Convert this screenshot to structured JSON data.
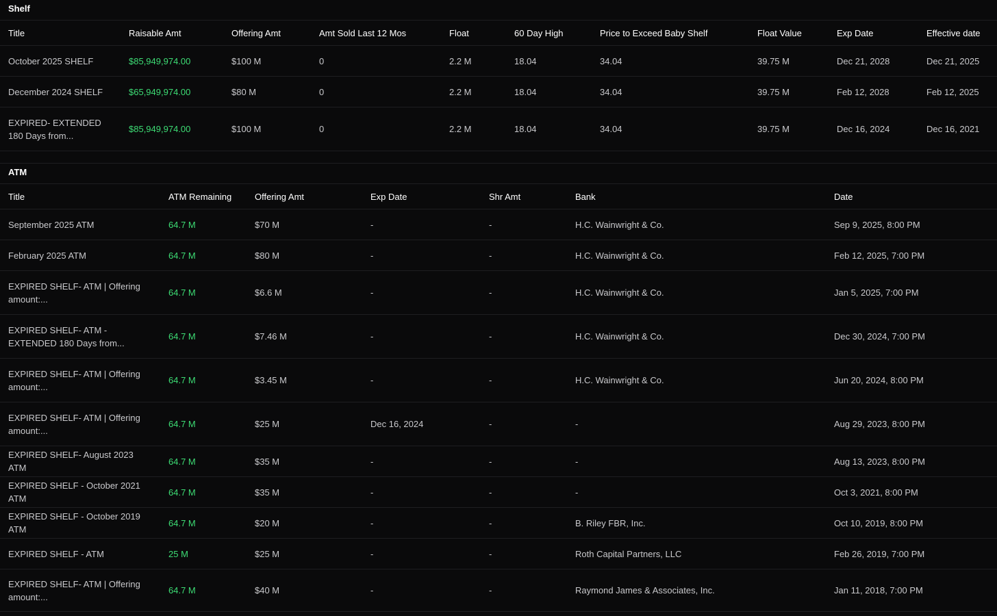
{
  "shelf": {
    "section_title": "Shelf",
    "columns": [
      "Title",
      "Raisable Amt",
      "Offering Amt",
      "Amt Sold Last 12 Mos",
      "Float",
      "60 Day High",
      "Price to Exceed Baby Shelf",
      "Float Value",
      "Exp Date",
      "Effective date"
    ],
    "rows": [
      {
        "title": "October 2025 SHELF",
        "raisable": "$85,949,974.00",
        "offering": "$100 M",
        "sold": "0",
        "float": "2.2 M",
        "high60": "18.04",
        "price_exceed": "34.04",
        "float_value": "39.75 M",
        "exp_date": "Dec 21, 2028",
        "effective": "Dec 21, 2025"
      },
      {
        "title": "December 2024 SHELF",
        "raisable": "$65,949,974.00",
        "offering": "$80 M",
        "sold": "0",
        "float": "2.2 M",
        "high60": "18.04",
        "price_exceed": "34.04",
        "float_value": "39.75 M",
        "exp_date": "Feb 12, 2028",
        "effective": "Feb 12, 2025"
      },
      {
        "title": "EXPIRED- EXTENDED 180 Days from...",
        "raisable": "$85,949,974.00",
        "offering": "$100 M",
        "sold": "0",
        "float": "2.2 M",
        "high60": "18.04",
        "price_exceed": "34.04",
        "float_value": "39.75 M",
        "exp_date": "Dec 16, 2024",
        "effective": "Dec 16, 2021"
      }
    ]
  },
  "atm": {
    "section_title": "ATM",
    "columns": [
      "Title",
      "ATM Remaining",
      "Offering Amt",
      "Exp Date",
      "Shr Amt",
      "Bank",
      "Date"
    ],
    "rows": [
      {
        "title": "September 2025 ATM",
        "remaining": "64.7 M",
        "offering": "$70 M",
        "exp_date": "-",
        "shr_amt": "-",
        "bank": "H.C. Wainwright & Co.",
        "date": "Sep 9, 2025, 8:00 PM"
      },
      {
        "title": "February 2025 ATM",
        "remaining": "64.7 M",
        "offering": "$80 M",
        "exp_date": "-",
        "shr_amt": "-",
        "bank": "H.C. Wainwright & Co.",
        "date": "Feb 12, 2025, 7:00 PM"
      },
      {
        "title": "EXPIRED SHELF- ATM | Offering amount:...",
        "remaining": "64.7 M",
        "offering": "$6.6 M",
        "exp_date": "-",
        "shr_amt": "-",
        "bank": "H.C. Wainwright & Co.",
        "date": "Jan 5, 2025, 7:00 PM"
      },
      {
        "title": "EXPIRED SHELF- ATM -EXTENDED 180 Days from...",
        "remaining": "64.7 M",
        "offering": "$7.46 M",
        "exp_date": "-",
        "shr_amt": "-",
        "bank": "H.C. Wainwright & Co.",
        "date": "Dec 30, 2024, 7:00 PM"
      },
      {
        "title": "EXPIRED SHELF- ATM | Offering amount:...",
        "remaining": "64.7 M",
        "offering": "$3.45 M",
        "exp_date": "-",
        "shr_amt": "-",
        "bank": "H.C. Wainwright & Co.",
        "date": "Jun 20, 2024, 8:00 PM"
      },
      {
        "title": "EXPIRED SHELF- ATM | Offering amount:...",
        "remaining": "64.7 M",
        "offering": "$25 M",
        "exp_date": "Dec 16, 2024",
        "shr_amt": "-",
        "bank": "-",
        "date": "Aug 29, 2023, 8:00 PM"
      },
      {
        "title": "EXPIRED SHELF- August 2023 ATM",
        "remaining": "64.7 M",
        "offering": "$35 M",
        "exp_date": "-",
        "shr_amt": "-",
        "bank": "-",
        "date": "Aug 13, 2023, 8:00 PM"
      },
      {
        "title": "EXPIRED SHELF - October 2021 ATM",
        "remaining": "64.7 M",
        "offering": "$35 M",
        "exp_date": "-",
        "shr_amt": "-",
        "bank": "-",
        "date": "Oct 3, 2021, 8:00 PM"
      },
      {
        "title": "EXPIRED SHELF - October 2019 ATM",
        "remaining": "64.7 M",
        "offering": "$20 M",
        "exp_date": "-",
        "shr_amt": "-",
        "bank": "B. Riley FBR, Inc.",
        "date": "Oct 10, 2019, 8:00 PM"
      },
      {
        "title": "EXPIRED SHELF - ATM",
        "remaining": "25 M",
        "offering": "$25 M",
        "exp_date": "-",
        "shr_amt": "-",
        "bank": "Roth Capital Partners, LLC",
        "date": "Feb 26, 2019, 7:00 PM"
      },
      {
        "title": "EXPIRED SHELF- ATM | Offering amount:...",
        "remaining": "64.7 M",
        "offering": "$40 M",
        "exp_date": "-",
        "shr_amt": "-",
        "bank": "Raymond James & Associates, Inc.",
        "date": "Jan 11, 2018, 7:00 PM"
      }
    ]
  },
  "colors": {
    "background": "#0a0a0b",
    "text": "#c9c9cc",
    "header_text": "#ffffff",
    "accent_green": "#3ddc74",
    "divider": "#1e1e21"
  }
}
